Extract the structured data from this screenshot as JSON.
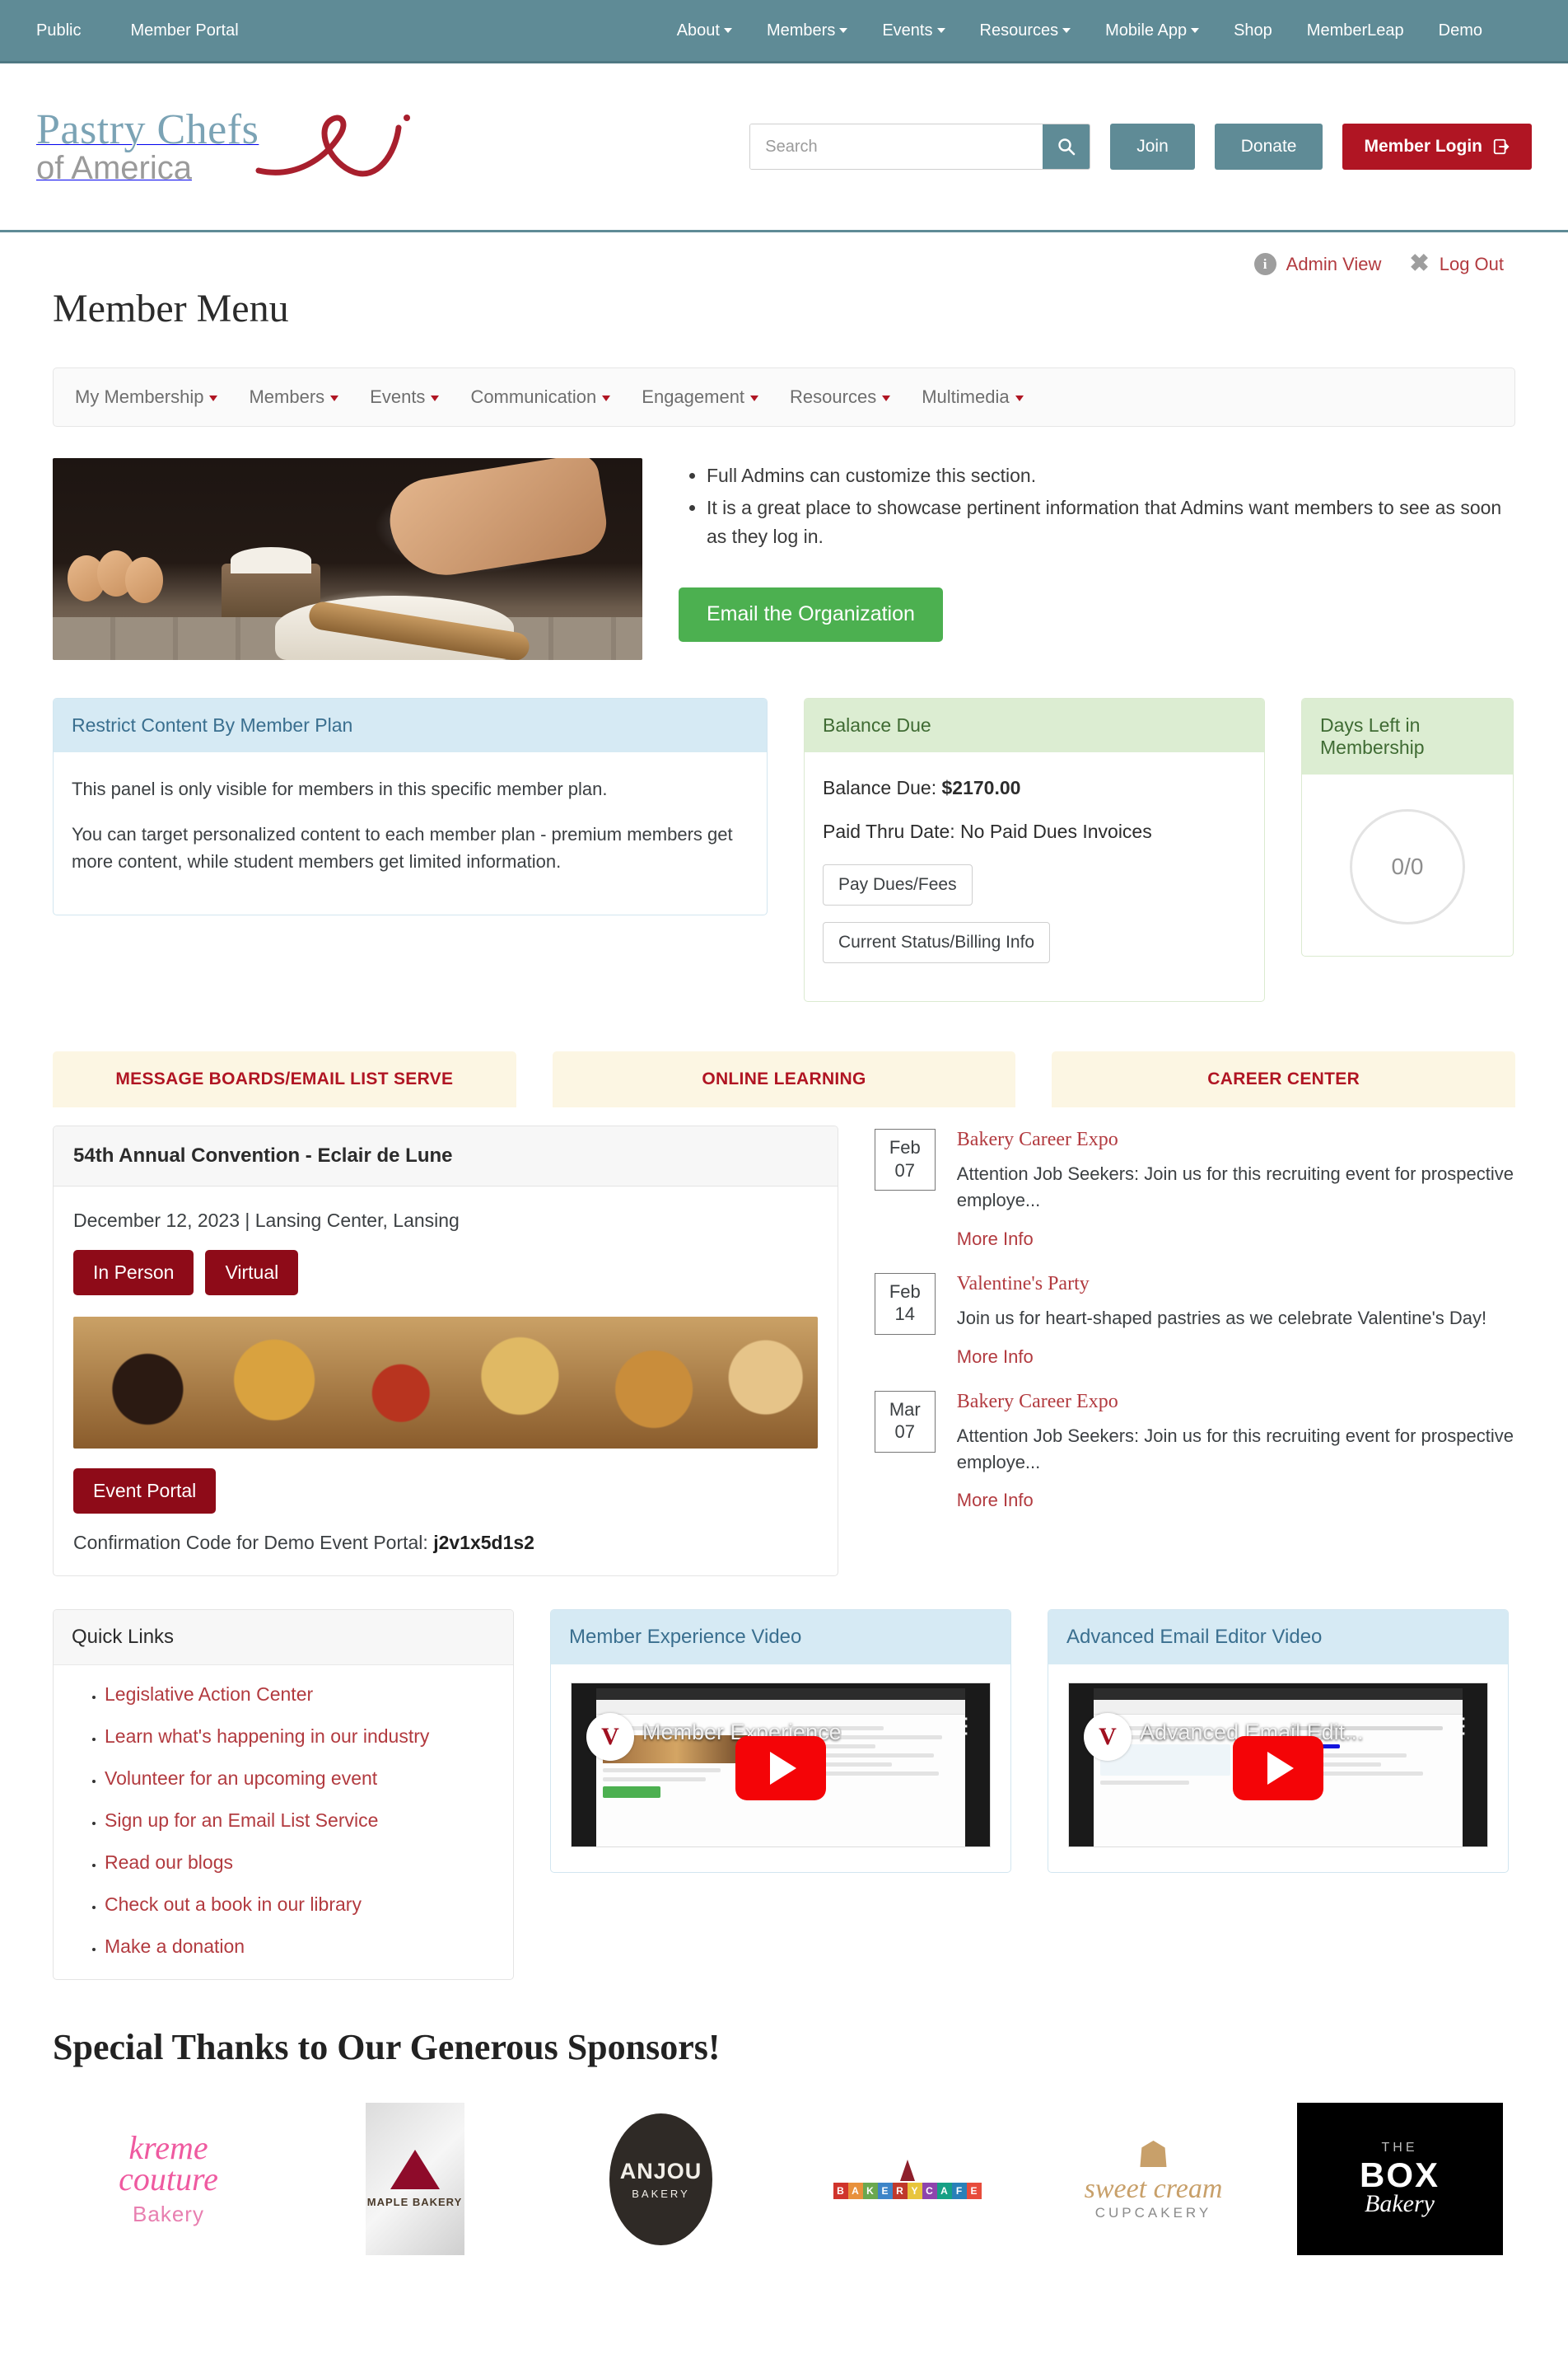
{
  "topbar": {
    "left_links": [
      {
        "label": "Public",
        "has_caret": false
      },
      {
        "label": "Member Portal",
        "has_caret": false
      }
    ],
    "right_links": [
      {
        "label": "About",
        "has_caret": true
      },
      {
        "label": "Members",
        "has_caret": true
      },
      {
        "label": "Events",
        "has_caret": true
      },
      {
        "label": "Resources",
        "has_caret": true
      },
      {
        "label": "Mobile App",
        "has_caret": true
      },
      {
        "label": "Shop",
        "has_caret": false
      },
      {
        "label": "MemberLeap",
        "has_caret": false
      },
      {
        "label": "Demo",
        "has_caret": false
      }
    ],
    "bg_color": "#5f8b96"
  },
  "brand": {
    "line1": "Pastry Chefs",
    "line2": "of America",
    "line1_color": "#7ba3b5",
    "swash_color": "#a81f2d"
  },
  "search": {
    "placeholder": "Search",
    "value": "",
    "icon": "search-icon"
  },
  "header_buttons": {
    "join": "Join",
    "donate": "Donate",
    "member_login": "Member Login",
    "login_icon": "sign-in-icon",
    "teal": "#5f8b96",
    "red": "#b01523"
  },
  "admin_row": {
    "admin_view": "Admin View",
    "log_out": "Log Out",
    "info_icon_letter": "i"
  },
  "page_title": "Member Menu",
  "member_nav": [
    {
      "label": "My Membership",
      "has_caret": true
    },
    {
      "label": "Members",
      "has_caret": true
    },
    {
      "label": "Events",
      "has_caret": true
    },
    {
      "label": "Communication",
      "has_caret": true
    },
    {
      "label": "Engagement",
      "has_caret": true
    },
    {
      "label": "Resources",
      "has_caret": true
    },
    {
      "label": "Multimedia",
      "has_caret": true
    }
  ],
  "hero": {
    "image_alt": "baker-kneading-dough-photo",
    "bullets": [
      "Full Admins can customize this section.",
      "It is a great place to showcase pertinent information that Admins want members to see as soon as they log in."
    ],
    "email_button": "Email the Organization",
    "email_button_color": "#4cb050"
  },
  "panels": {
    "restrict": {
      "title": "Restrict Content By Member Plan",
      "paragraphs": [
        "This panel is only visible for members in this specific member plan.",
        "You can target personalized content to each member plan - premium members get more content, while student members get limited information."
      ]
    },
    "balance": {
      "title": "Balance Due",
      "balance_label": "Balance Due:",
      "balance_value": "$2170.00",
      "paid_thru": "Paid Thru Date: No Paid Dues Invoices",
      "pay_button": "Pay Dues/Fees",
      "status_button": "Current Status/Billing Info"
    },
    "days_left": {
      "title": "Days Left in Membership",
      "value": "0/0"
    }
  },
  "tabs": [
    {
      "label": "MESSAGE BOARDS/EMAIL LIST SERVE",
      "active": true
    },
    {
      "label": "ONLINE LEARNING",
      "active": false
    },
    {
      "label": "CAREER CENTER",
      "active": false
    }
  ],
  "event_card": {
    "title": "54th Annual Convention - Eclair de Lune",
    "date_location": "December 12, 2023 | Lansing Center, Lansing",
    "pills": [
      "In Person",
      "Virtual"
    ],
    "photo_alt": "assorted-pastries-photo",
    "portal_button": "Event Portal",
    "confirmation_label": "Confirmation Code for Demo Event Portal:",
    "confirmation_code": "j2v1x5d1s2"
  },
  "career_items": [
    {
      "month": "Feb",
      "day": "07",
      "title": "Bakery Career Expo",
      "description": "Attention Job Seekers: Join us for this recruiting event for prospective employe...",
      "more_info": "More Info"
    },
    {
      "month": "Feb",
      "day": "14",
      "title": "Valentine's Party",
      "description": "Join us for heart-shaped pastries as we celebrate Valentine's Day!",
      "more_info": "More Info"
    },
    {
      "month": "Mar",
      "day": "07",
      "title": "Bakery Career Expo",
      "description": "Attention Job Seekers: Join us for this recruiting event for prospective employe...",
      "more_info": "More Info"
    }
  ],
  "quick_links": {
    "title": "Quick Links",
    "items": [
      "Legislative Action Center",
      "Learn what's happening in our industry",
      "Volunteer for an upcoming event",
      "Sign up for an Email List Service",
      "Read our blogs",
      "Check out a book in our library",
      "Make a donation"
    ]
  },
  "videos": [
    {
      "panel_title": "Member Experience Video",
      "overlay_title": "Member Experience"
    },
    {
      "panel_title": "Advanced Email Editor Video",
      "overlay_title": "Advanced Email Edit..."
    }
  ],
  "sponsors": {
    "heading": "Special Thanks to Our Generous Sponsors!",
    "logos": [
      {
        "name": "kreme couture Bakery",
        "word1": "kreme",
        "word2": "couture",
        "word3": "Bakery"
      },
      {
        "name": "MAPLE BAKERY",
        "label": "MAPLE  BAKERY"
      },
      {
        "name": "ANJOU BAKERY",
        "word1": "ANJOU",
        "word2": "BAKERY"
      },
      {
        "name": "BAKERY CAFE",
        "letters": "BAKERY CAFE"
      },
      {
        "name": "sweet cream CUPCAKERY",
        "word1": "sweet cream",
        "word2": "CUPCAKERY"
      },
      {
        "name": "THE BOX Bakery",
        "word1": "THE",
        "word2": "BOX",
        "word3": "Bakery"
      }
    ]
  }
}
